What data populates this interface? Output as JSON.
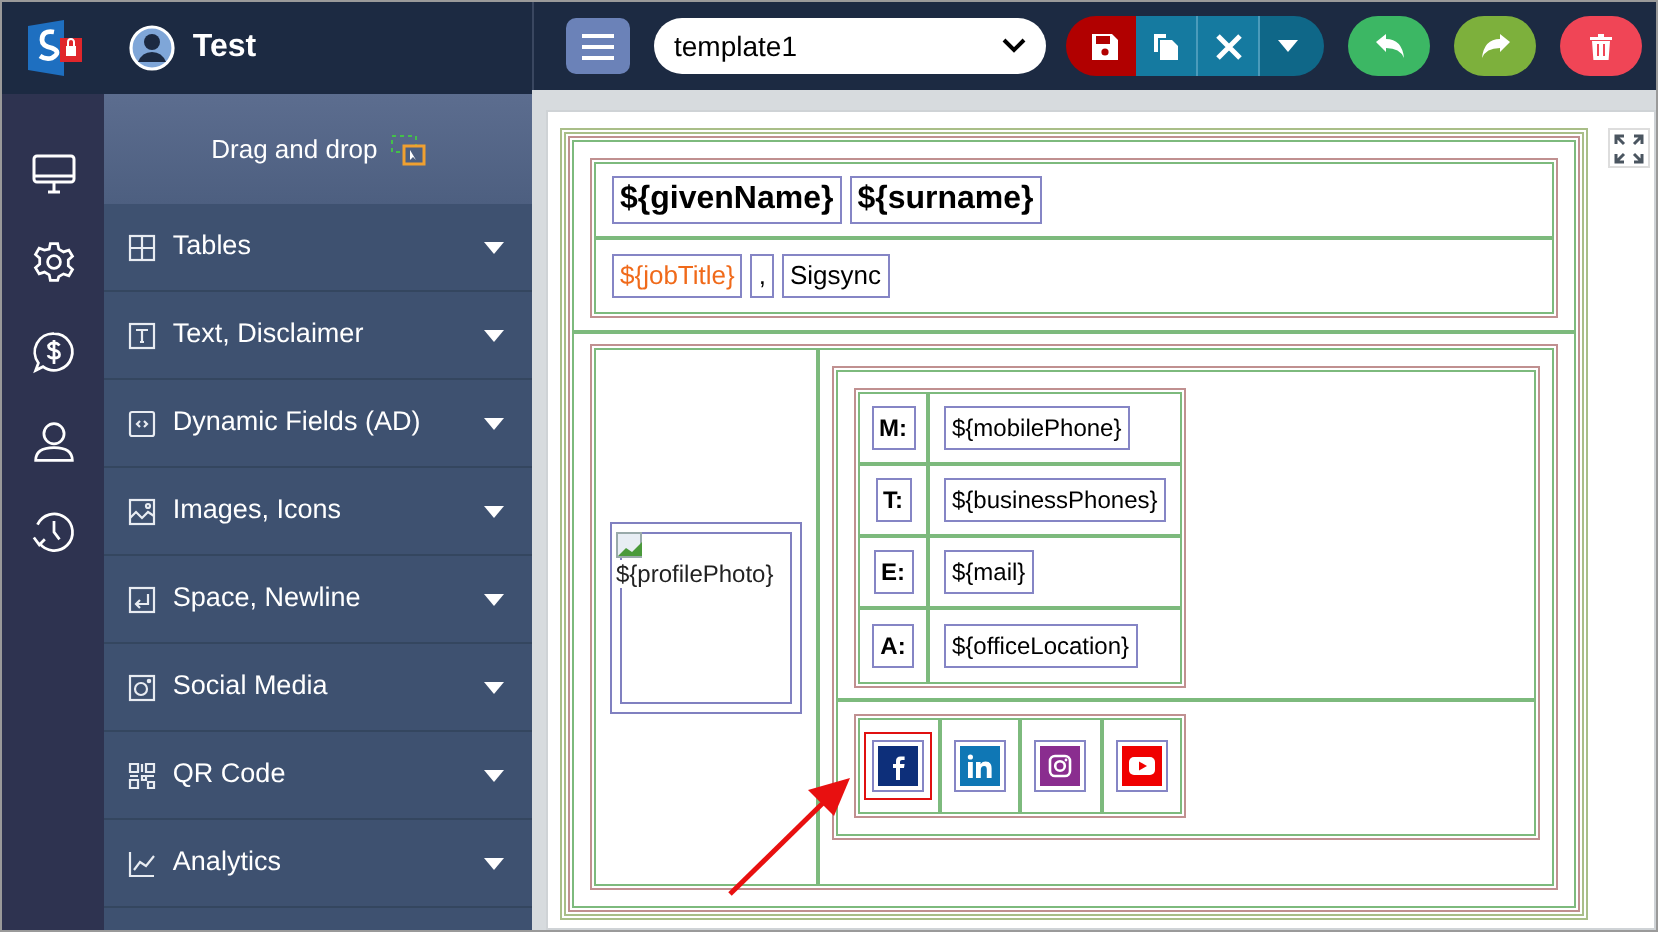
{
  "app": {
    "title": "Test"
  },
  "template_select": {
    "value": "template1"
  },
  "sidebar": {
    "header": "Drag and drop",
    "items": [
      {
        "kind": "table",
        "label": "Tables"
      },
      {
        "kind": "text",
        "label": "Text, Disclaimer"
      },
      {
        "kind": "code",
        "label": "Dynamic Fields (AD)"
      },
      {
        "kind": "image",
        "label": "Images, Icons"
      },
      {
        "kind": "newline",
        "label": "Space, Newline"
      },
      {
        "kind": "social",
        "label": "Social Media"
      },
      {
        "kind": "qr",
        "label": "QR Code"
      },
      {
        "kind": "chart",
        "label": "Analytics"
      }
    ]
  },
  "signature": {
    "name_fields": [
      "${givenName}",
      "${surname}"
    ],
    "title_fields": [
      {
        "kind": "accent",
        "text": "${jobTitle}"
      },
      {
        "kind": "plain",
        "text": ","
      },
      {
        "kind": "plain",
        "text": "Sigsync"
      }
    ],
    "photo_placeholder": "${profilePhoto}",
    "contacts": [
      {
        "label": "M:",
        "value": "${mobilePhone}"
      },
      {
        "label": "T:",
        "value": "${businessPhones}"
      },
      {
        "label": "E:",
        "value": "${mail}"
      },
      {
        "label": "A:",
        "value": "${officeLocation}"
      }
    ],
    "social": [
      {
        "kind": "facebook",
        "selected": true
      },
      {
        "kind": "linkedin",
        "selected": false
      },
      {
        "kind": "instagram",
        "selected": false
      },
      {
        "kind": "youtube",
        "selected": false
      }
    ]
  }
}
